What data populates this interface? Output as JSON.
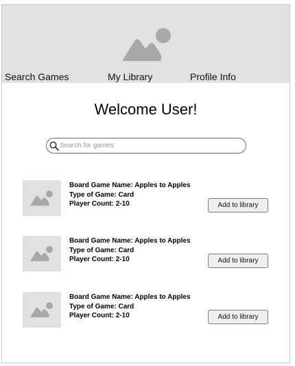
{
  "header": {
    "hero_image": "image-placeholder-icon",
    "nav": [
      "Search Games",
      "My Library",
      "Profile Info"
    ]
  },
  "main": {
    "welcome": "Welcome User!",
    "search": {
      "placeholder": "Search for games",
      "value": "",
      "icon": "search-icon"
    },
    "games": [
      {
        "thumbnail": "image-placeholder-icon",
        "name": "Board Game Name: Apples to Apples",
        "type": "Type of Game: Card",
        "players": "Player Count: 2-10",
        "button": "Add to library"
      },
      {
        "thumbnail": "image-placeholder-icon",
        "name": "Board Game Name: Apples to Apples",
        "type": "Type of Game: Card",
        "players": "Player Count: 2-10",
        "button": "Add to library"
      },
      {
        "thumbnail": "image-placeholder-icon",
        "name": "Board Game Name: Apples to Apples",
        "type": "Type of Game: Card",
        "players": "Player Count: 2-10",
        "button": "Add to library"
      }
    ]
  },
  "colors": {
    "header_bg": "#e1e1e1",
    "placeholder_icon": "#a8a8a8",
    "button_bg": "#efefef"
  }
}
